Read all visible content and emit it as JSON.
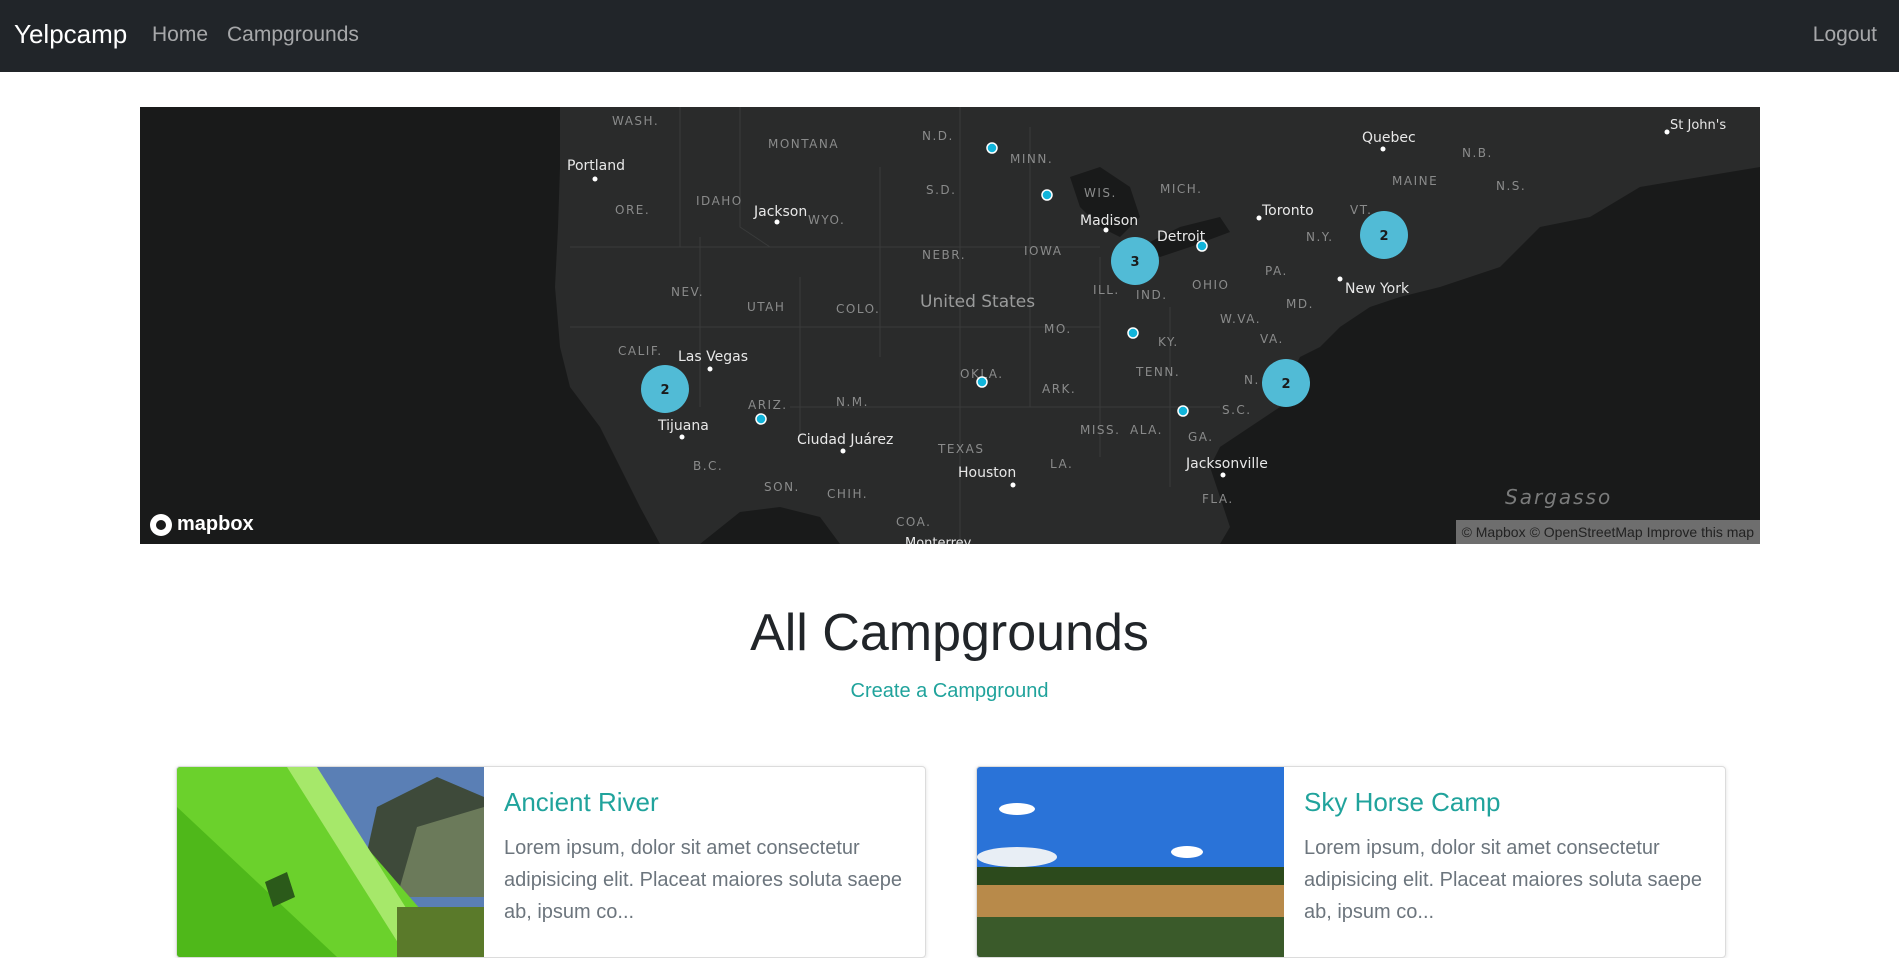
{
  "navbar": {
    "brand": "Yelpcamp",
    "home": "Home",
    "campgrounds": "Campgrounds",
    "logout": "Logout"
  },
  "map": {
    "country_label": "United States",
    "labels": {
      "wash": "WASH.",
      "montana": "MONTANA",
      "nd": "N.D.",
      "minn": "MINN.",
      "sd": "S.D.",
      "wis": "WIS.",
      "mich": "MICH.",
      "idaho": "IDAHO",
      "ore": "ORE.",
      "wyo": "WYO.",
      "nebr": "NEBR.",
      "iowa": "IOWA",
      "nev": "NEV.",
      "utah": "UTAH",
      "colo": "COLO.",
      "ill": "ILL.",
      "ind": "IND.",
      "ohio": "OHIO",
      "pa": "PA.",
      "ny": "N.Y.",
      "vt": "VT.",
      "maine": "MAINE",
      "nb": "N.B.",
      "ns": "N.S.",
      "md": "MD.",
      "wva": "W.VA.",
      "va": "VA.",
      "ky": "KY.",
      "mo": "MO.",
      "calif": "CALIF.",
      "okla": "OKLA.",
      "ark": "ARK.",
      "tenn": "TENN.",
      "nc": "N.",
      "sc": "S.C.",
      "ariz": "ARIZ.",
      "nm": "N.M.",
      "miss": "MISS.",
      "ala": "ALA.",
      "ga": "GA.",
      "texas": "TEXAS",
      "la": "LA.",
      "bc": "B.C.",
      "son": "SON.",
      "chih": "CHIH.",
      "coa": "COA.",
      "fla": "FLA."
    },
    "cities": {
      "portland": "Portland",
      "jackson": "Jackson",
      "madison": "Madison",
      "detroit": "Detroit",
      "toronto": "Toronto",
      "quebec": "Quebec",
      "stjohns": "St John's",
      "newyork": "New York",
      "lasvegas": "Las Vegas",
      "tijuana": "Tijuana",
      "ciudadjuarez": "Ciudad Juárez",
      "houston": "Houston",
      "jacksonville": "Jacksonville",
      "monterrey": "Monterrey"
    },
    "ocean_label": "Sargasso",
    "clusters": [
      "3",
      "2",
      "2",
      "2"
    ],
    "logo_text": "mapbox",
    "attribution": {
      "mapbox": "© Mapbox",
      "osm": "© OpenStreetMap",
      "improve": "Improve this map"
    },
    "colors": {
      "background": "#191a1a",
      "cluster": "#51bbd6",
      "land": "#2a2b2b"
    }
  },
  "page": {
    "title": "All Campgrounds",
    "create_link": "Create a Campground"
  },
  "campgrounds": [
    {
      "title": "Ancient River",
      "description": "Lorem ipsum, dolor sit amet consectetur adipisicing elit. Placeat maiores soluta saepe ab, ipsum co..."
    },
    {
      "title": "Sky Horse Camp",
      "description": "Lorem ipsum, dolor sit amet consectetur adipisicing elit. Placeat maiores soluta saepe ab, ipsum co..."
    }
  ]
}
